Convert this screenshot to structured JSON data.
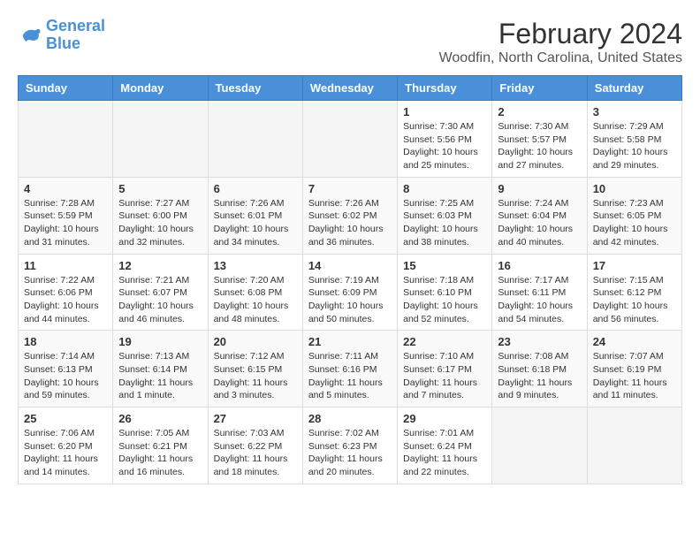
{
  "header": {
    "logo_line1": "General",
    "logo_line2": "Blue",
    "title": "February 2024",
    "subtitle": "Woodfin, North Carolina, United States"
  },
  "days_of_week": [
    "Sunday",
    "Monday",
    "Tuesday",
    "Wednesday",
    "Thursday",
    "Friday",
    "Saturday"
  ],
  "weeks": [
    [
      {
        "day": "",
        "info": ""
      },
      {
        "day": "",
        "info": ""
      },
      {
        "day": "",
        "info": ""
      },
      {
        "day": "",
        "info": ""
      },
      {
        "day": "1",
        "info": "Sunrise: 7:30 AM\nSunset: 5:56 PM\nDaylight: 10 hours\nand 25 minutes."
      },
      {
        "day": "2",
        "info": "Sunrise: 7:30 AM\nSunset: 5:57 PM\nDaylight: 10 hours\nand 27 minutes."
      },
      {
        "day": "3",
        "info": "Sunrise: 7:29 AM\nSunset: 5:58 PM\nDaylight: 10 hours\nand 29 minutes."
      }
    ],
    [
      {
        "day": "4",
        "info": "Sunrise: 7:28 AM\nSunset: 5:59 PM\nDaylight: 10 hours\nand 31 minutes."
      },
      {
        "day": "5",
        "info": "Sunrise: 7:27 AM\nSunset: 6:00 PM\nDaylight: 10 hours\nand 32 minutes."
      },
      {
        "day": "6",
        "info": "Sunrise: 7:26 AM\nSunset: 6:01 PM\nDaylight: 10 hours\nand 34 minutes."
      },
      {
        "day": "7",
        "info": "Sunrise: 7:26 AM\nSunset: 6:02 PM\nDaylight: 10 hours\nand 36 minutes."
      },
      {
        "day": "8",
        "info": "Sunrise: 7:25 AM\nSunset: 6:03 PM\nDaylight: 10 hours\nand 38 minutes."
      },
      {
        "day": "9",
        "info": "Sunrise: 7:24 AM\nSunset: 6:04 PM\nDaylight: 10 hours\nand 40 minutes."
      },
      {
        "day": "10",
        "info": "Sunrise: 7:23 AM\nSunset: 6:05 PM\nDaylight: 10 hours\nand 42 minutes."
      }
    ],
    [
      {
        "day": "11",
        "info": "Sunrise: 7:22 AM\nSunset: 6:06 PM\nDaylight: 10 hours\nand 44 minutes."
      },
      {
        "day": "12",
        "info": "Sunrise: 7:21 AM\nSunset: 6:07 PM\nDaylight: 10 hours\nand 46 minutes."
      },
      {
        "day": "13",
        "info": "Sunrise: 7:20 AM\nSunset: 6:08 PM\nDaylight: 10 hours\nand 48 minutes."
      },
      {
        "day": "14",
        "info": "Sunrise: 7:19 AM\nSunset: 6:09 PM\nDaylight: 10 hours\nand 50 minutes."
      },
      {
        "day": "15",
        "info": "Sunrise: 7:18 AM\nSunset: 6:10 PM\nDaylight: 10 hours\nand 52 minutes."
      },
      {
        "day": "16",
        "info": "Sunrise: 7:17 AM\nSunset: 6:11 PM\nDaylight: 10 hours\nand 54 minutes."
      },
      {
        "day": "17",
        "info": "Sunrise: 7:15 AM\nSunset: 6:12 PM\nDaylight: 10 hours\nand 56 minutes."
      }
    ],
    [
      {
        "day": "18",
        "info": "Sunrise: 7:14 AM\nSunset: 6:13 PM\nDaylight: 10 hours\nand 59 minutes."
      },
      {
        "day": "19",
        "info": "Sunrise: 7:13 AM\nSunset: 6:14 PM\nDaylight: 11 hours\nand 1 minute."
      },
      {
        "day": "20",
        "info": "Sunrise: 7:12 AM\nSunset: 6:15 PM\nDaylight: 11 hours\nand 3 minutes."
      },
      {
        "day": "21",
        "info": "Sunrise: 7:11 AM\nSunset: 6:16 PM\nDaylight: 11 hours\nand 5 minutes."
      },
      {
        "day": "22",
        "info": "Sunrise: 7:10 AM\nSunset: 6:17 PM\nDaylight: 11 hours\nand 7 minutes."
      },
      {
        "day": "23",
        "info": "Sunrise: 7:08 AM\nSunset: 6:18 PM\nDaylight: 11 hours\nand 9 minutes."
      },
      {
        "day": "24",
        "info": "Sunrise: 7:07 AM\nSunset: 6:19 PM\nDaylight: 11 hours\nand 11 minutes."
      }
    ],
    [
      {
        "day": "25",
        "info": "Sunrise: 7:06 AM\nSunset: 6:20 PM\nDaylight: 11 hours\nand 14 minutes."
      },
      {
        "day": "26",
        "info": "Sunrise: 7:05 AM\nSunset: 6:21 PM\nDaylight: 11 hours\nand 16 minutes."
      },
      {
        "day": "27",
        "info": "Sunrise: 7:03 AM\nSunset: 6:22 PM\nDaylight: 11 hours\nand 18 minutes."
      },
      {
        "day": "28",
        "info": "Sunrise: 7:02 AM\nSunset: 6:23 PM\nDaylight: 11 hours\nand 20 minutes."
      },
      {
        "day": "29",
        "info": "Sunrise: 7:01 AM\nSunset: 6:24 PM\nDaylight: 11 hours\nand 22 minutes."
      },
      {
        "day": "",
        "info": ""
      },
      {
        "day": "",
        "info": ""
      }
    ]
  ]
}
